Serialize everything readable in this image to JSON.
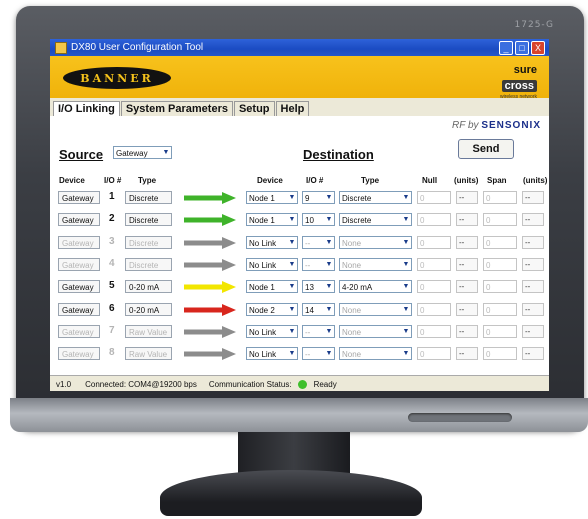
{
  "monitor": {
    "brand": "1725-G"
  },
  "window": {
    "title": "DX80 User Configuration Tool",
    "min": "_",
    "max": "□",
    "close": "X"
  },
  "banner": {
    "logo": "BANNER",
    "sure": "sure",
    "cross": "cross",
    "tagline": "wireless network"
  },
  "tabs": [
    {
      "label": "I/O Linking"
    },
    {
      "label": "System Parameters"
    },
    {
      "label": "Setup"
    },
    {
      "label": "Help"
    }
  ],
  "rfby": {
    "prefix": "RF by",
    "brand": "SENSONIX"
  },
  "source": {
    "heading": "Source",
    "device": "Gateway"
  },
  "destination": {
    "heading": "Destination"
  },
  "send_label": "Send",
  "columns": {
    "device": "Device",
    "io": "I/O #",
    "type": "Type",
    "ddevice": "Device",
    "dio": "I/O #",
    "dtype": "Type",
    "null": "Null",
    "units": "(units)",
    "span": "Span",
    "units2": "(units)"
  },
  "rows": [
    {
      "src": "Gateway",
      "io": "1",
      "type": "Discrete",
      "arrow": "green",
      "dev": "Node 1",
      "dio": "9",
      "dtype": "Discrete",
      "null": "0",
      "nunit": "--",
      "span": "0",
      "sunit": "--",
      "disabled": false,
      "ddis": false
    },
    {
      "src": "Gateway",
      "io": "2",
      "type": "Discrete",
      "arrow": "green",
      "dev": "Node 1",
      "dio": "10",
      "dtype": "Discrete",
      "null": "0",
      "nunit": "--",
      "span": "0",
      "sunit": "--",
      "disabled": false,
      "ddis": false
    },
    {
      "src": "Gateway",
      "io": "3",
      "type": "Discrete",
      "arrow": "gray",
      "dev": "No Link",
      "dio": "--",
      "dtype": "None",
      "null": "0",
      "nunit": "--",
      "span": "0",
      "sunit": "--",
      "disabled": true,
      "ddis": true
    },
    {
      "src": "Gateway",
      "io": "4",
      "type": "Discrete",
      "arrow": "gray",
      "dev": "No Link",
      "dio": "--",
      "dtype": "None",
      "null": "0",
      "nunit": "--",
      "span": "0",
      "sunit": "--",
      "disabled": true,
      "ddis": true
    },
    {
      "src": "Gateway",
      "io": "5",
      "type": "0-20 mA",
      "arrow": "yellow",
      "dev": "Node 1",
      "dio": "13",
      "dtype": "4-20 mA",
      "null": "0",
      "nunit": "--",
      "span": "0",
      "sunit": "--",
      "disabled": false,
      "ddis": false
    },
    {
      "src": "Gateway",
      "io": "6",
      "type": "0-20 mA",
      "arrow": "red",
      "dev": "Node 2",
      "dio": "14",
      "dtype": "None",
      "null": "0",
      "nunit": "--",
      "span": "0",
      "sunit": "--",
      "disabled": false,
      "ddis": true
    },
    {
      "src": "Gateway",
      "io": "7",
      "type": "Raw Value",
      "arrow": "gray",
      "dev": "No Link",
      "dio": "--",
      "dtype": "None",
      "null": "0",
      "nunit": "--",
      "span": "0",
      "sunit": "--",
      "disabled": true,
      "ddis": true
    },
    {
      "src": "Gateway",
      "io": "8",
      "type": "Raw Value",
      "arrow": "gray",
      "dev": "No Link",
      "dio": "--",
      "dtype": "None",
      "null": "0",
      "nunit": "--",
      "span": "0",
      "sunit": "--",
      "disabled": true,
      "ddis": true
    }
  ],
  "colors": {
    "green": "#3fb32a",
    "gray": "#8c8c8c",
    "yellow": "#f2e600",
    "red": "#d8261d"
  },
  "status": {
    "version": "v1.0",
    "connection": "Connected: COM4@19200 bps",
    "comm_label": "Communication Status:",
    "comm_value": "Ready"
  }
}
